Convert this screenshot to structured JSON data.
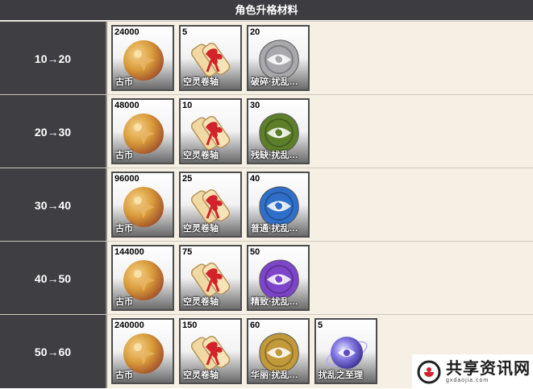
{
  "title": "角色升格材料",
  "rows": [
    {
      "level": "10→20",
      "items": [
        {
          "count": "24000",
          "name": "古币",
          "icon": "coin-icon"
        },
        {
          "count": "5",
          "name": "空灵卷轴",
          "icon": "scroll-icon"
        },
        {
          "count": "20",
          "name": "破碎·扰乱…",
          "icon": "seal-icon",
          "color": "#a9a9ad"
        }
      ]
    },
    {
      "level": "20→30",
      "items": [
        {
          "count": "48000",
          "name": "古币",
          "icon": "coin-icon"
        },
        {
          "count": "10",
          "name": "空灵卷轴",
          "icon": "scroll-icon"
        },
        {
          "count": "30",
          "name": "残缺·扰乱…",
          "icon": "seal-icon",
          "color": "#5d7f2a"
        }
      ]
    },
    {
      "level": "30→40",
      "items": [
        {
          "count": "96000",
          "name": "古币",
          "icon": "coin-icon"
        },
        {
          "count": "25",
          "name": "空灵卷轴",
          "icon": "scroll-icon"
        },
        {
          "count": "40",
          "name": "普通·扰乱…",
          "icon": "seal-icon",
          "color": "#2f6fc9"
        }
      ]
    },
    {
      "level": "40→50",
      "items": [
        {
          "count": "144000",
          "name": "古币",
          "icon": "coin-icon"
        },
        {
          "count": "75",
          "name": "空灵卷轴",
          "icon": "scroll-icon"
        },
        {
          "count": "50",
          "name": "精致·扰乱…",
          "icon": "seal-icon",
          "color": "#7d45c9"
        }
      ]
    },
    {
      "level": "50→60",
      "items": [
        {
          "count": "240000",
          "name": "古币",
          "icon": "coin-icon"
        },
        {
          "count": "150",
          "name": "空灵卷轴",
          "icon": "scroll-icon"
        },
        {
          "count": "60",
          "name": "华丽·扰乱…",
          "icon": "seal-icon",
          "color": "#c29a3a"
        },
        {
          "count": "5",
          "name": "扰乱之至理",
          "icon": "orb-icon"
        }
      ]
    }
  ],
  "watermark": {
    "title": "共享资讯网",
    "url": "gxdaojia.com",
    "icon": "logo-icon"
  },
  "colors": {
    "header": "#3c3c41",
    "level_cell": "#3e3e43",
    "item_area": "#f6f0e4",
    "coin": "#d89a3a",
    "ribbon": "#d2232a"
  }
}
